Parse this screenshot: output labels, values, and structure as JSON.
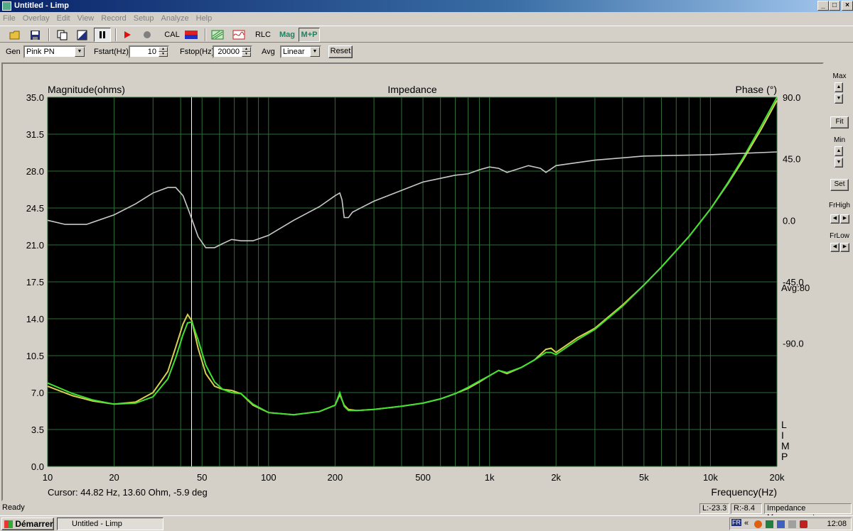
{
  "window": {
    "title": "Untitled - Limp"
  },
  "menu": [
    "File",
    "Overlay",
    "Edit",
    "View",
    "Record",
    "Setup",
    "Analyze",
    "Help"
  ],
  "toolbar": {
    "cal": "CAL",
    "rlc": "RLC",
    "mag": "Mag",
    "mp": "M+P"
  },
  "controls": {
    "gen_label": "Gen",
    "gen_value": "Pink PN",
    "fstart_label": "Fstart(Hz)",
    "fstart_value": "10",
    "fstop_label": "Fstop(Hz)",
    "fstop_value": "20000",
    "avg_label": "Avg",
    "avg_value": "Linear",
    "reset": "Reset"
  },
  "side": {
    "max": "Max",
    "fit": "Fit",
    "min": "Min",
    "set": "Set",
    "frhigh": "FrHigh",
    "frlow": "FrLow"
  },
  "chart_data": {
    "type": "line",
    "title": "Impedance",
    "ylabel": "Magnitude(ohms)",
    "y2label": "Phase (°)",
    "xlabel": "Frequency(Hz)",
    "xscale": "log",
    "xlim": [
      10,
      20000
    ],
    "ylim": [
      0,
      35
    ],
    "y2lim": [
      -180,
      90
    ],
    "xticks": [
      10,
      20,
      50,
      100,
      200,
      500,
      1000,
      2000,
      5000,
      10000,
      20000
    ],
    "xtick_labels": [
      "10",
      "20",
      "50",
      "100",
      "200",
      "500",
      "1k",
      "2k",
      "5k",
      "10k",
      "20k"
    ],
    "yticks": [
      0,
      3.5,
      7,
      10.5,
      14,
      17.5,
      21,
      24.5,
      28,
      31.5,
      35
    ],
    "ytick_labels": [
      "0.0",
      "3.5",
      "7.0",
      "10.5",
      "14.0",
      "17.5",
      "21.0",
      "24.5",
      "28.0",
      "31.5",
      "35.0"
    ],
    "y2ticks": [
      -90,
      -45,
      0,
      45,
      90
    ],
    "y2tick_labels": [
      "-90.0",
      "-45.0",
      "0.0",
      "45.0",
      "90.0"
    ],
    "avg_text": "Avg:80",
    "limp_text": [
      "L",
      "I",
      "M",
      "P"
    ],
    "cursor_x": 44.82,
    "cursor_text": "Cursor: 44.82 Hz, 13.60 Ohm, -5.9 deg",
    "grid": true,
    "series": [
      {
        "axis": "left",
        "color": "#d8d050",
        "x": [
          10,
          13,
          16,
          20,
          25,
          30,
          35,
          38,
          41,
          43,
          45,
          48,
          52,
          57,
          62,
          68,
          75,
          85,
          100,
          130,
          170,
          200,
          210,
          220,
          230,
          250,
          300,
          400,
          500,
          600,
          700,
          800,
          900,
          1000,
          1100,
          1200,
          1400,
          1600,
          1800,
          1900,
          2000,
          2500,
          3000,
          4000,
          5000,
          6000,
          8000,
          10000,
          12000,
          14000,
          17000,
          20000
        ],
        "y": [
          7.6,
          6.7,
          6.2,
          5.9,
          6.1,
          7.0,
          9.0,
          11.3,
          13.5,
          14.4,
          13.8,
          11.2,
          8.8,
          7.6,
          7.3,
          7.2,
          6.9,
          5.8,
          5.1,
          4.9,
          5.2,
          5.8,
          6.8,
          5.8,
          5.4,
          5.3,
          5.4,
          5.7,
          6.0,
          6.4,
          6.9,
          7.4,
          8.0,
          8.6,
          9.1,
          8.8,
          9.4,
          10.1,
          11.1,
          11.2,
          10.8,
          12.2,
          13.1,
          15.3,
          17.2,
          18.9,
          21.8,
          24.4,
          26.8,
          29.0,
          32.0,
          34.7
        ]
      },
      {
        "axis": "left",
        "color": "#40e030",
        "x": [
          10,
          13,
          16,
          20,
          25,
          30,
          35,
          38,
          41,
          43,
          45,
          48,
          52,
          57,
          62,
          68,
          75,
          85,
          100,
          130,
          170,
          200,
          210,
          220,
          230,
          250,
          300,
          400,
          500,
          600,
          700,
          800,
          900,
          1000,
          1100,
          1200,
          1400,
          1600,
          1800,
          1900,
          2000,
          2500,
          3000,
          4000,
          5000,
          6000,
          8000,
          10000,
          12000,
          14000,
          17000,
          20000
        ],
        "y": [
          7.9,
          6.9,
          6.3,
          5.9,
          6.0,
          6.6,
          8.3,
          10.3,
          12.5,
          13.6,
          13.7,
          12.0,
          9.6,
          8.0,
          7.3,
          7.0,
          6.9,
          5.9,
          5.1,
          4.9,
          5.2,
          5.8,
          7.0,
          5.7,
          5.3,
          5.3,
          5.4,
          5.7,
          6.0,
          6.4,
          6.9,
          7.5,
          8.1,
          8.6,
          9.1,
          8.9,
          9.4,
          10.1,
          10.8,
          10.8,
          10.6,
          12.0,
          13.0,
          15.2,
          17.2,
          18.9,
          21.8,
          24.4,
          26.9,
          29.2,
          32.3,
          35.0
        ]
      },
      {
        "axis": "right",
        "color": "#c8c8c8",
        "x": [
          10,
          12,
          15,
          20,
          25,
          30,
          35,
          38,
          41,
          44,
          48,
          52,
          57,
          62,
          68,
          75,
          85,
          100,
          130,
          170,
          200,
          210,
          215,
          220,
          230,
          240,
          300,
          500,
          700,
          800,
          900,
          1000,
          1100,
          1200,
          1500,
          1700,
          1800,
          2000,
          3000,
          5000,
          10000,
          20000
        ],
        "y": [
          0,
          -3,
          -3,
          4,
          12,
          20,
          24,
          24,
          18,
          5,
          -12,
          -20,
          -20,
          -17,
          -14,
          -15,
          -15,
          -11,
          0,
          10,
          18,
          20,
          15,
          2,
          2,
          6,
          14,
          28,
          33,
          34,
          37,
          39,
          38,
          35,
          40,
          38,
          35,
          40,
          44,
          47,
          48,
          50
        ]
      }
    ]
  },
  "status": {
    "ready": "Ready",
    "l": "L:-23.3",
    "r": "R:-8.4",
    "mode": "Impedance Measurement"
  },
  "taskbar": {
    "start": "Démarrer",
    "task": "Untitled - Limp",
    "lang": "FR",
    "time": "12:08"
  }
}
